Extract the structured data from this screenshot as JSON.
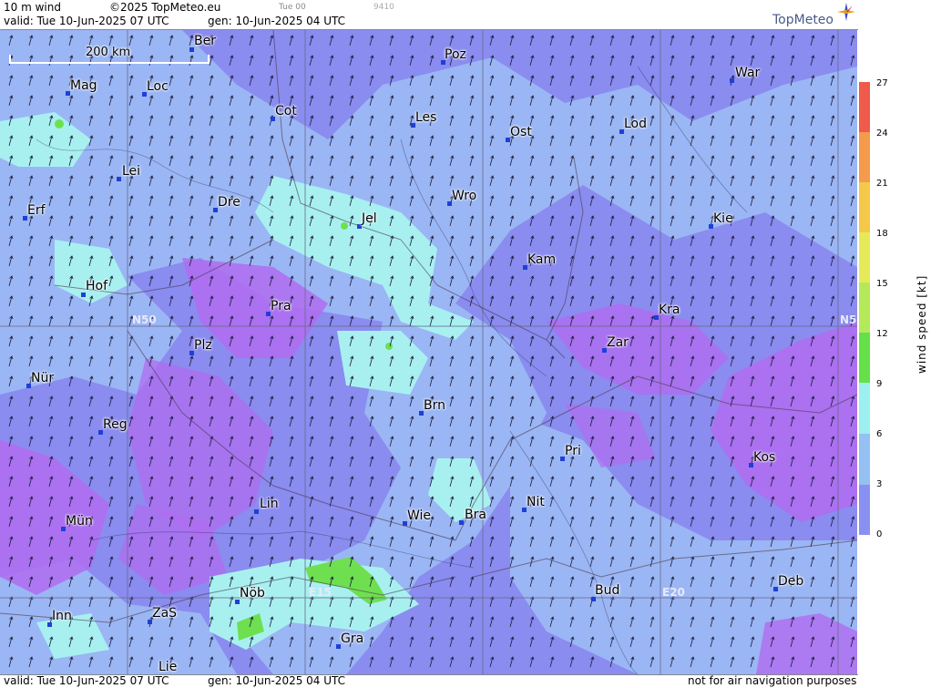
{
  "header": {
    "title": "10 m wind",
    "copyright": "©2025 TopMeteo.eu",
    "small_time": "Tue 00",
    "small_code": "9410",
    "valid": "valid:  Tue  10-Jun-2025  07 UTC",
    "gen": "gen: 10-Jun-2025 04 UTC",
    "logo": "TopMeteo"
  },
  "footer": {
    "valid": "valid:  Tue  10-Jun-2025  07 UTC",
    "gen": "gen: 10-Jun-2025 04 UTC",
    "note": "not for air navigation purposes"
  },
  "scale_bar": "200 km",
  "grid_labels": {
    "n50_left": "N50",
    "n50_right": "N5",
    "e15": "E15",
    "e20": "E20"
  },
  "cities": [
    "Ber",
    "Poz",
    "War",
    "Mag",
    "Loc",
    "Cot",
    "Les",
    "Ost",
    "Lod",
    "Lei",
    "Erf",
    "Dre",
    "Jel",
    "Wro",
    "Kie",
    "Kam",
    "Hof",
    "Pra",
    "Kra",
    "Zar",
    "Plz",
    "Nür",
    "Brn",
    "Reg",
    "Pri",
    "Kos",
    "Lin",
    "Nit",
    "Wie",
    "Bra",
    "Mün",
    "Nöb",
    "Deb",
    "Bud",
    "Inn",
    "ZaS",
    "Gra",
    "Lie"
  ],
  "colorbar": {
    "label": "wind  speed  [kt]",
    "ticks": [
      "27",
      "24",
      "21",
      "18",
      "15",
      "12",
      "9",
      "6",
      "3",
      "0"
    ],
    "colors": [
      "#ef5a4a",
      "#f59a4a",
      "#f5c84a",
      "#e6ea58",
      "#b4ea5a",
      "#64e048",
      "#9cf0f0",
      "#94c0f4",
      "#8a90f2",
      "#b26ef0"
    ]
  }
}
